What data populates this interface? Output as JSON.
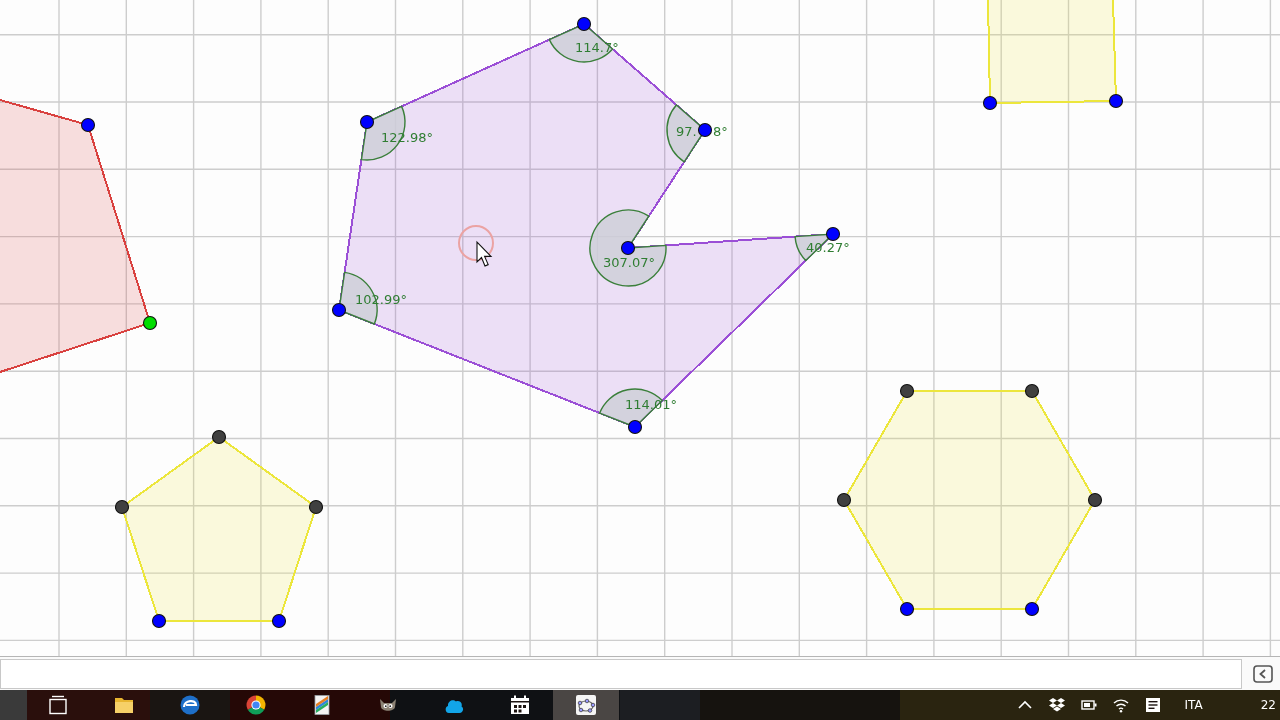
{
  "graphics_view": {
    "polygons": [
      {
        "color": "#d9413f",
        "vertices": [
          {
            "color": "#0000ff"
          },
          {
            "color": "#00dd00"
          }
        ]
      },
      {
        "color": "#9b4fd6",
        "vertices": [
          {
            "color": "#0000ff",
            "angle": {
              "label": "114.7°"
            }
          },
          {
            "color": "#0000ff",
            "angle": {
              "label": "97.",
              "label_after_point": "8°"
            }
          },
          {
            "color": "#0000ff",
            "angle": {
              "label": "307.07°"
            }
          },
          {
            "color": "#0000ff",
            "angle": {
              "label": "40.27°"
            }
          },
          {
            "color": "#0000ff",
            "angle": {
              "label": "114.01°"
            }
          },
          {
            "color": "#0000ff",
            "angle": {
              "label": "102.99°"
            }
          },
          {
            "color": "#0000ff",
            "angle": {
              "label": "122.98°"
            }
          }
        ]
      },
      {
        "color": "#ece63c",
        "vertices": [
          {
            "color": "#0000ff"
          },
          {
            "color": "#0000ff"
          }
        ]
      },
      {
        "color": "#ece63c",
        "vertices": [
          {
            "color": "#404040"
          },
          {
            "color": "#404040"
          },
          {
            "color": "#0000ff"
          },
          {
            "color": "#0000ff"
          },
          {
            "color": "#404040"
          }
        ]
      },
      {
        "color": "#ece63c",
        "vertices": [
          {
            "color": "#404040"
          },
          {
            "color": "#404040"
          },
          {
            "color": "#404040"
          },
          {
            "color": "#0000ff"
          },
          {
            "color": "#0000ff"
          },
          {
            "color": "#404040"
          }
        ]
      }
    ]
  },
  "taskbar": {
    "apps": [
      {
        "kind": "window-stack",
        "selected": false
      },
      {
        "kind": "folder",
        "selected": false
      },
      {
        "kind": "swirl",
        "selected": false
      },
      {
        "kind": "segmented-circle",
        "selected": false
      },
      {
        "kind": "document",
        "selected": false
      },
      {
        "kind": "animal",
        "selected": false
      },
      {
        "kind": "cloud",
        "selected": false
      },
      {
        "kind": "calendar",
        "selected": false
      },
      {
        "kind": "dotted-ellipse",
        "selected": true
      }
    ],
    "tray": {
      "language": "ITA",
      "clock": "22"
    }
  }
}
